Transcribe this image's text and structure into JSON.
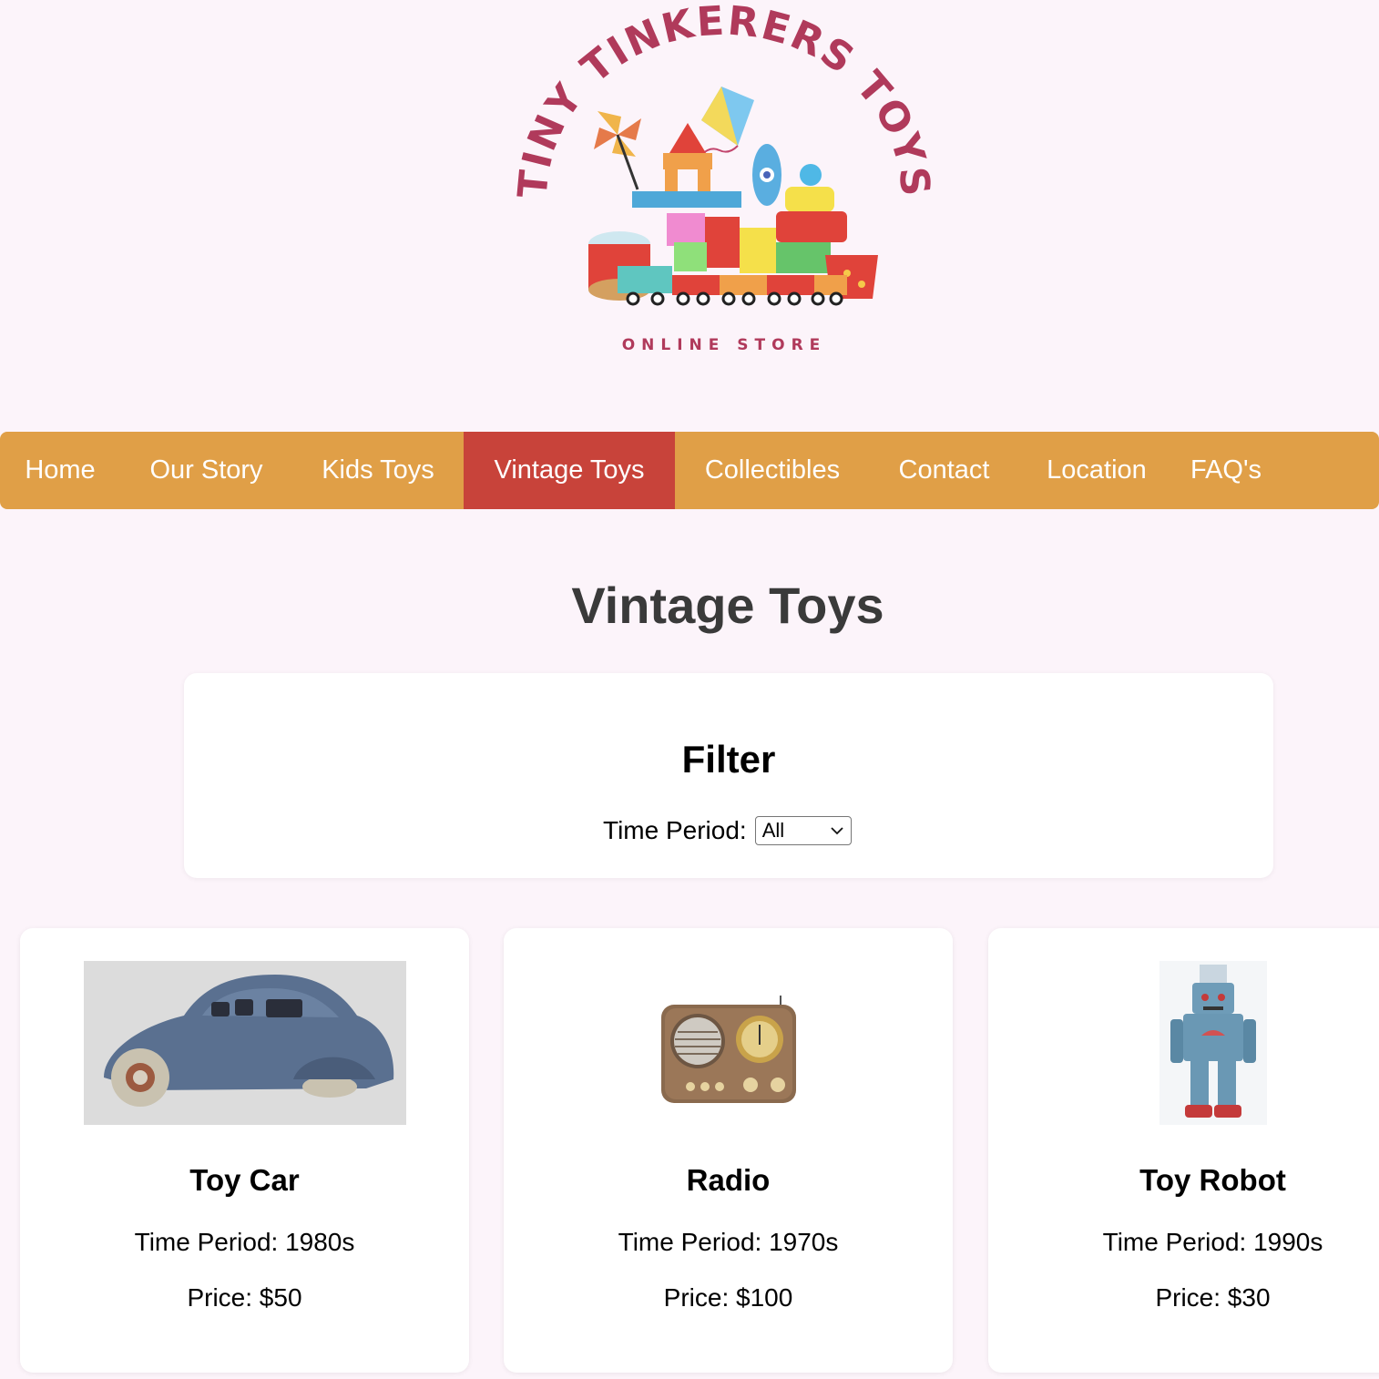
{
  "logo": {
    "arc_text": "TINY TINKERERS TOYS",
    "subtitle": "ONLINE STORE",
    "brand_color": "#b03a5b"
  },
  "nav": {
    "items": [
      {
        "label": "Home",
        "active": false
      },
      {
        "label": "Our Story",
        "active": false
      },
      {
        "label": "Kids Toys",
        "active": false
      },
      {
        "label": "Vintage Toys",
        "active": true
      },
      {
        "label": "Collectibles",
        "active": false
      },
      {
        "label": "Contact",
        "active": false
      },
      {
        "label": "Location",
        "active": false
      },
      {
        "label": "FAQ's",
        "active": false
      }
    ],
    "bg_color": "#e09f47",
    "active_color": "#c8433a"
  },
  "page": {
    "title": "Vintage Toys",
    "background": "#fcf4fa"
  },
  "filter": {
    "title": "Filter",
    "label": "Time Period:",
    "selected": "All"
  },
  "products": [
    {
      "name": "Toy Car",
      "period": "Time Period: 1980s",
      "price": "Price: $50",
      "image": "vintage-car-image"
    },
    {
      "name": "Radio",
      "period": "Time Period: 1970s",
      "price": "Price: $100",
      "image": "vintage-radio-image"
    },
    {
      "name": "Toy Robot",
      "period": "Time Period: 1990s",
      "price": "Price: $30",
      "image": "toy-robot-image"
    }
  ]
}
